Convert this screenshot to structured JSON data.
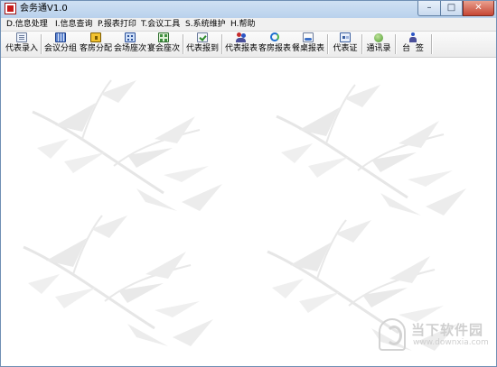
{
  "window": {
    "title": "会务通V1.0",
    "minimize": "–",
    "maximize": "□",
    "close": "✕"
  },
  "menu": {
    "items": [
      {
        "label": "D.信息处理"
      },
      {
        "label": "I.信息查询"
      },
      {
        "label": "P.报表打印"
      },
      {
        "label": "T.会议工具"
      },
      {
        "label": "S.系统维护"
      },
      {
        "label": "H.帮助"
      }
    ]
  },
  "toolbar": {
    "buttons": [
      {
        "label": "代表录入",
        "icon": "document-icon"
      },
      {
        "label": "会议分组",
        "icon": "grid-icon"
      },
      {
        "label": "客房分配",
        "icon": "room-icon"
      },
      {
        "label": "会场座次",
        "icon": "seating-icon"
      },
      {
        "label": "宴会座次",
        "icon": "banquet-icon"
      },
      {
        "label": "代表报到",
        "icon": "check-in-icon"
      },
      {
        "label": "代表报表",
        "icon": "people-report-icon"
      },
      {
        "label": "客房报表",
        "icon": "refresh-report-icon"
      },
      {
        "label": "餐桌报表",
        "icon": "table-report-icon"
      },
      {
        "label": "代表证",
        "icon": "badge-card-icon"
      },
      {
        "label": "通讯录",
        "icon": "address-book-icon"
      },
      {
        "label": "台  签",
        "icon": "table-sign-icon"
      }
    ]
  },
  "watermark": {
    "name": "当下软件园",
    "url": "www.downxia.com"
  }
}
